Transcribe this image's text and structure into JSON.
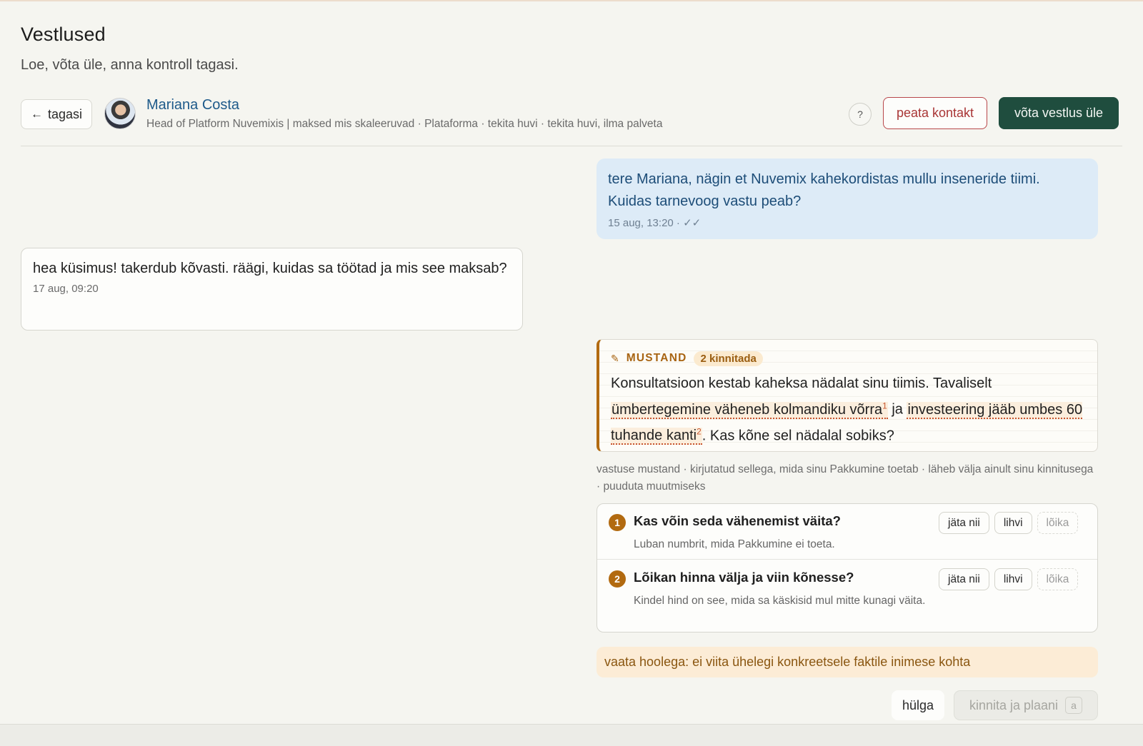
{
  "page": {
    "title": "Vestlused",
    "subtitle": "Loe, võta üle, anna kontroll tagasi."
  },
  "header": {
    "back_label": "tagasi",
    "contact_name": "Mariana Costa",
    "contact_meta": "Head of Platform Nuvemixis | maksed mis skaleeruvad · Plataforma · tekita huvi · tekita huvi, ilma palveta",
    "help_label": "?",
    "stop_contact_label": "peata kontakt",
    "take_over_label": "võta vestlus üle"
  },
  "messages": [
    {
      "direction": "outgoing",
      "text": "tere Mariana, nägin et Nuvemix kahekordistas mullu inseneride tiimi. Kuidas tarnevoog vastu peab?",
      "meta": "15 aug, 13:20 · ✓✓"
    },
    {
      "direction": "incoming",
      "text": "hea küsimus! takerdub kõvasti. räägi, kuidas sa töötad ja mis see maksab?",
      "meta": "17 aug, 09:20"
    }
  ],
  "draft": {
    "label": "MUSTAND",
    "confirm_badge": "2 kinnitada",
    "text_before": "Konsultatsioon kestab kaheksa nädalat sinu tiimis. Tavaliselt ",
    "claim_1": "ümbertegemine väheneb kolmandiku võrra",
    "claim_1_ref": "1",
    "text_between": " ja ",
    "claim_2": "investeering jääb umbes 60 tuhande kanti",
    "claim_2_ref": "2",
    "text_after": ". Kas kõne sel nädalal sobiks?",
    "note": "vastuse mustand · kirjutatud sellega, mida sinu Pakkumine toetab · läheb välja ainult sinu kinnitusega · puuduta muutmiseks"
  },
  "questions": [
    {
      "number": "1",
      "title": "Kas võin seda vähenemist väita?",
      "description": "Luban numbrit, mida Pakkumine ei toeta.",
      "actions": [
        "jäta nii",
        "lihvi",
        "lõika"
      ]
    },
    {
      "number": "2",
      "title": "Lõikan hinna välja ja viin kõnesse?",
      "description": "Kindel hind on see, mida sa käskisid mul mitte kunagi väita.",
      "actions": [
        "jäta nii",
        "lihvi",
        "lõika"
      ]
    }
  ],
  "warning": "vaata hoolega: ei viita ühelegi konkreetsele faktile inimese kohta",
  "footer": {
    "reject_label": "hülga",
    "confirm_schedule_label": "kinnita ja plaani",
    "shortcut_key": "a"
  },
  "colors": {
    "accent_dark_green": "#1f4d3e",
    "danger_red": "#a93636",
    "draft_amber": "#b26a10",
    "outgoing_bubble": "#ddebf7",
    "warning_bg": "#fcecd6"
  },
  "icons": {
    "back": "arrow-left-icon",
    "draft": "pencil-icon",
    "read_receipt": "double-check-icon"
  }
}
